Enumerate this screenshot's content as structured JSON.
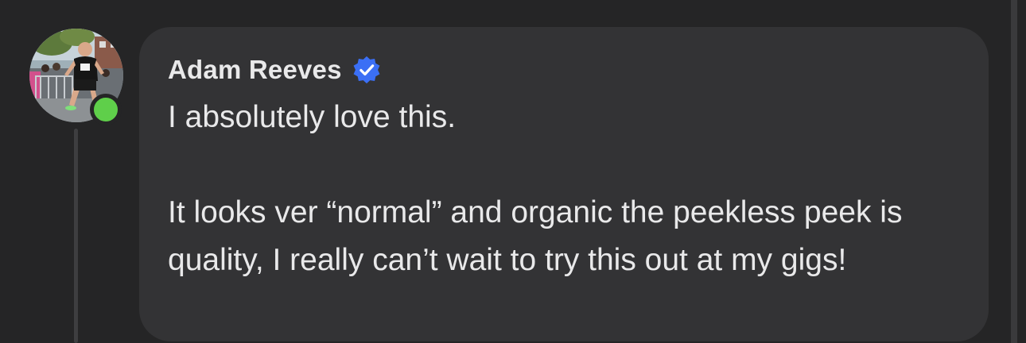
{
  "comment": {
    "author": {
      "name": "Adam Reeves",
      "verified": true,
      "online": true,
      "avatar_icon": "runner-photo-avatar",
      "verified_badge_color": "#3b6ff5",
      "online_indicator_color": "#5fcf4a"
    },
    "paragraphs": [
      "I absolutely love this.",
      "It looks ver “normal” and organic the peekless peek is quality, I really can’t wait to try this out at my gigs!"
    ]
  }
}
